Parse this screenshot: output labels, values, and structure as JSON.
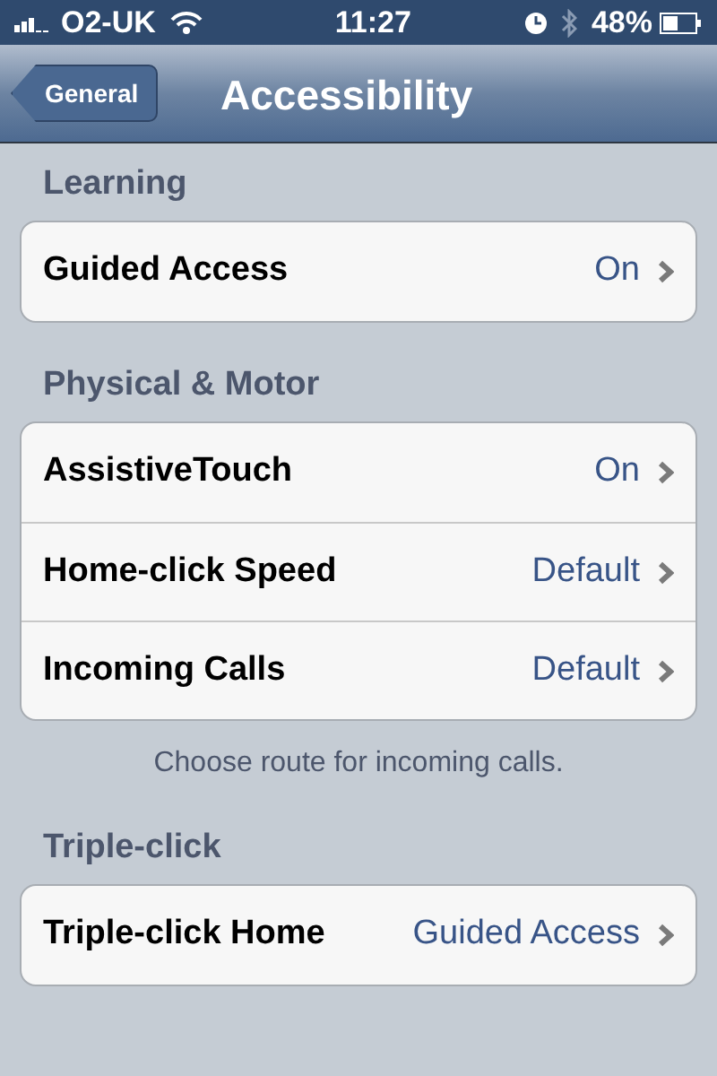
{
  "status_bar": {
    "carrier": "O2-UK",
    "time": "11:27",
    "battery": "48%"
  },
  "nav_bar": {
    "back": "General",
    "title": "Accessibility"
  },
  "sections": [
    {
      "header": "Learning",
      "rows": [
        {
          "label": "Guided Access",
          "value": "On"
        }
      ]
    },
    {
      "header": "Physical & Motor",
      "rows": [
        {
          "label": "AssistiveTouch",
          "value": "On"
        },
        {
          "label": "Home-click Speed",
          "value": "Default"
        },
        {
          "label": "Incoming Calls",
          "value": "Default"
        }
      ],
      "footer": "Choose route for incoming calls."
    },
    {
      "header": "Triple-click",
      "rows": [
        {
          "label": "Triple-click Home",
          "value": "Guided Access"
        }
      ]
    }
  ]
}
